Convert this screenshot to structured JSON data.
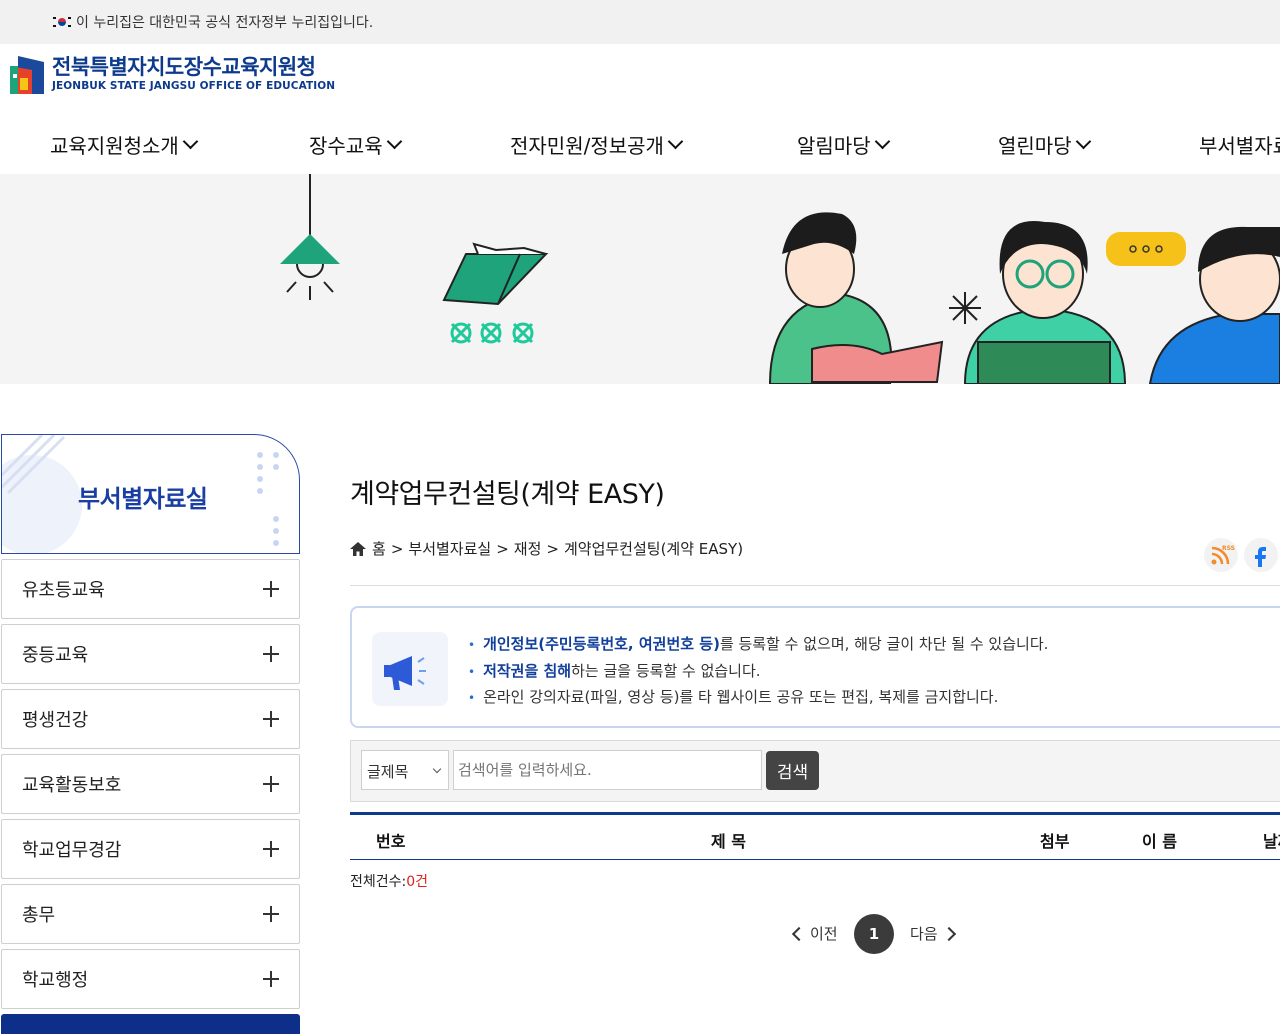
{
  "topbar": {
    "notice": "이 누리집은 대한민국 공식 전자정부 누리집입니다."
  },
  "header": {
    "logo_title": "전북특별자치도장수교육지원청",
    "logo_subtitle": "JEONBUK STATE JANGSU OFFICE OF EDUCATION",
    "nav": [
      "교육지원청소개",
      "장수교육",
      "전자민원/정보공개",
      "알림마당",
      "열린마당",
      "부서별자료실"
    ]
  },
  "sidebar": {
    "title": "부서별자료실",
    "items": [
      "유초등교육",
      "중등교육",
      "평생건강",
      "교육활동보호",
      "학교업무경감",
      "총무",
      "학교행정"
    ]
  },
  "main": {
    "title": "계약업무컨설팅(계약 EASY)",
    "breadcrumb": [
      "홈",
      "부서별자료실",
      "재정",
      "계약업무컨설팅(계약 EASY)"
    ],
    "notice": {
      "line1_bold": "개인정보(주민등록번호, 여권번호 등)",
      "line1_rest": "를 등록할 수 없으며, 해당 글이 차단 될 수 있습니다.",
      "line2_bold": "저작권을 침해",
      "line2_rest": "하는 글을 등록할 수 없습니다.",
      "line3": "온라인 강의자료(파일, 영상 등)를 타 웹사이트 공유 또는 편집, 복제를 금지합니다."
    },
    "search": {
      "select_value": "글제목",
      "placeholder": "검색어를 입력하세요.",
      "button": "검색"
    },
    "table_headers": [
      "번호",
      "제 목",
      "첨부",
      "이 름",
      "날짜"
    ],
    "total_label": "전체건수:",
    "total_count": "0건",
    "pager": {
      "prev": "이전",
      "current": "1",
      "next": "다음"
    }
  },
  "share_icons": [
    "rss-icon",
    "facebook-icon"
  ],
  "colors": {
    "brand": "#0d3a8c",
    "accent_red": "#e0201f",
    "sidebar_title": "#1a3ea3"
  }
}
